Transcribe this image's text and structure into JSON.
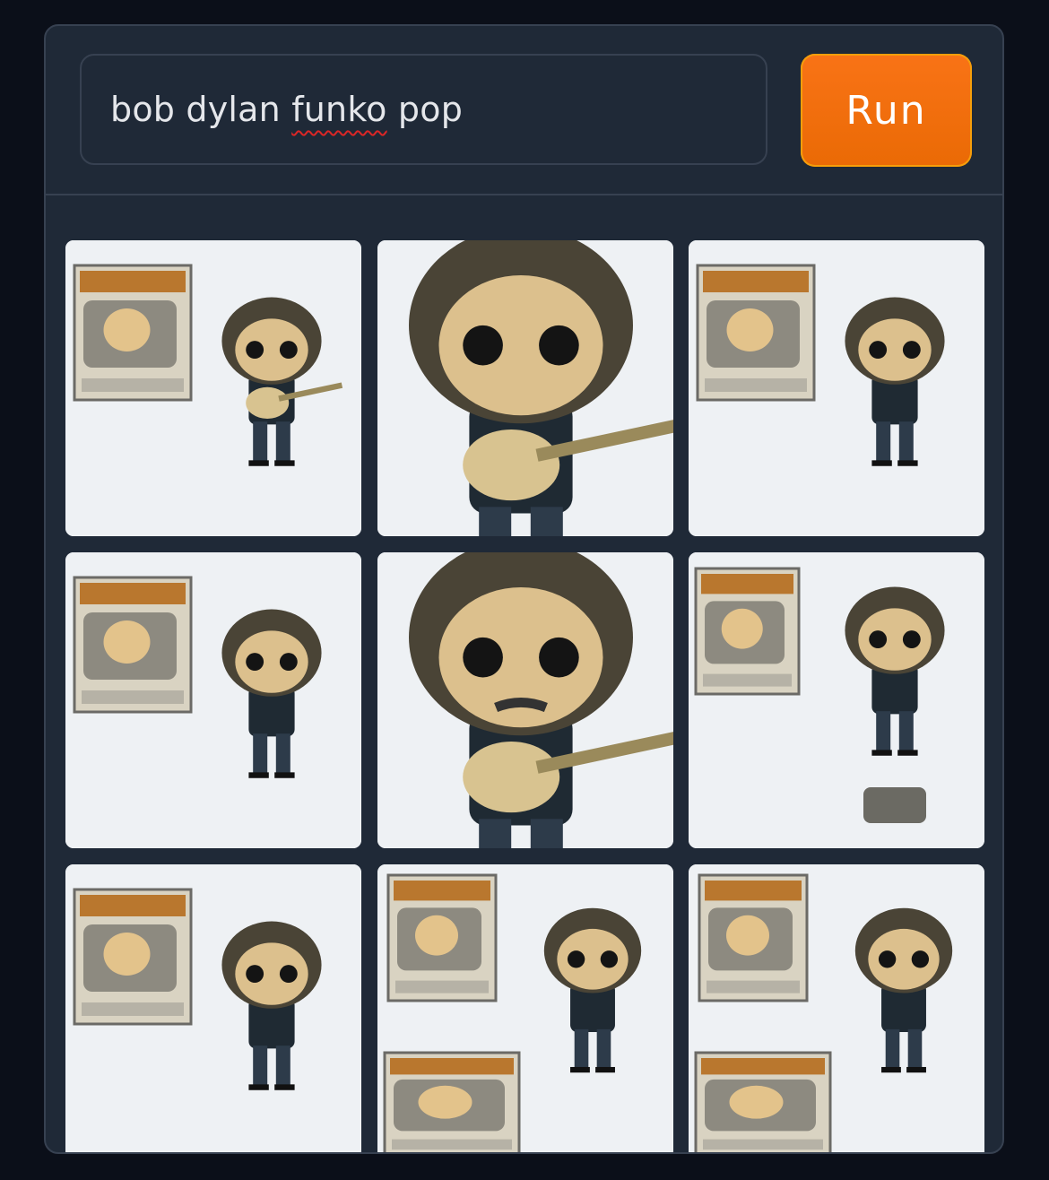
{
  "prompt": {
    "value_before": "bob dylan ",
    "value_misspelled": "funko",
    "value_after": " pop"
  },
  "run_button": {
    "label": "Run"
  },
  "colors": {
    "background": "#0b0f19",
    "panel": "#1f2937",
    "border": "#374151",
    "accent": "#f97316",
    "text": "#e5e7eb"
  },
  "gallery": {
    "images": [
      {
        "name": "generated-image-1",
        "variant": "box-and-figure-guitar"
      },
      {
        "name": "generated-image-2",
        "variant": "closeup-guitar"
      },
      {
        "name": "generated-image-3",
        "variant": "box-and-figure"
      },
      {
        "name": "generated-image-4",
        "variant": "box-and-figure"
      },
      {
        "name": "generated-image-5",
        "variant": "closeup-guitar-beard"
      },
      {
        "name": "generated-image-6",
        "variant": "box-and-figure-stand"
      },
      {
        "name": "generated-image-7",
        "variant": "box-and-figure"
      },
      {
        "name": "generated-image-8",
        "variant": "two-boxes-and-figure"
      },
      {
        "name": "generated-image-9",
        "variant": "two-boxes-and-figure"
      }
    ]
  }
}
